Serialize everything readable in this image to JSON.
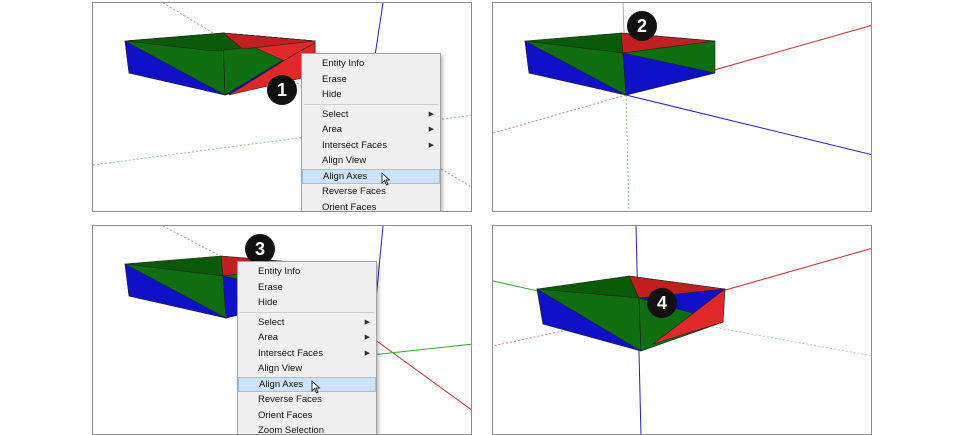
{
  "panels": [
    {
      "badge": "1",
      "menu": {
        "items": [
          {
            "label": "Entity Info",
            "submenu": false
          },
          {
            "label": "Erase",
            "submenu": false
          },
          {
            "label": "Hide",
            "submenu": false
          },
          {
            "label": "Select",
            "submenu": true
          },
          {
            "label": "Area",
            "submenu": true
          },
          {
            "label": "Intersect Faces",
            "submenu": true
          },
          {
            "label": "Align View",
            "submenu": false
          },
          {
            "label": "Align Axes",
            "submenu": false,
            "highlighted": true
          },
          {
            "label": "Reverse Faces",
            "submenu": false
          },
          {
            "label": "Orient Faces",
            "submenu": false
          }
        ]
      }
    },
    {
      "badge": "2"
    },
    {
      "badge": "3",
      "menu": {
        "items": [
          {
            "label": "Entity Info",
            "submenu": false
          },
          {
            "label": "Erase",
            "submenu": false
          },
          {
            "label": "Hide",
            "submenu": false
          },
          {
            "label": "Select",
            "submenu": true
          },
          {
            "label": "Area",
            "submenu": true
          },
          {
            "label": "Intersect Faces",
            "submenu": true
          },
          {
            "label": "Align View",
            "submenu": false
          },
          {
            "label": "Align Axes",
            "submenu": false,
            "highlighted": true
          },
          {
            "label": "Reverse Faces",
            "submenu": false
          },
          {
            "label": "Orient Faces",
            "submenu": false
          },
          {
            "label": "Zoom Selection",
            "submenu": false
          }
        ]
      }
    },
    {
      "badge": "4"
    }
  ],
  "colors": {
    "face_red": "#e02828",
    "face_green": "#0f6e10",
    "face_blue": "#1010c8",
    "axis_red": "#d03030",
    "axis_green": "#2fa82f",
    "axis_blue": "#2020d0",
    "menu_highlight": "#cde3f7"
  }
}
